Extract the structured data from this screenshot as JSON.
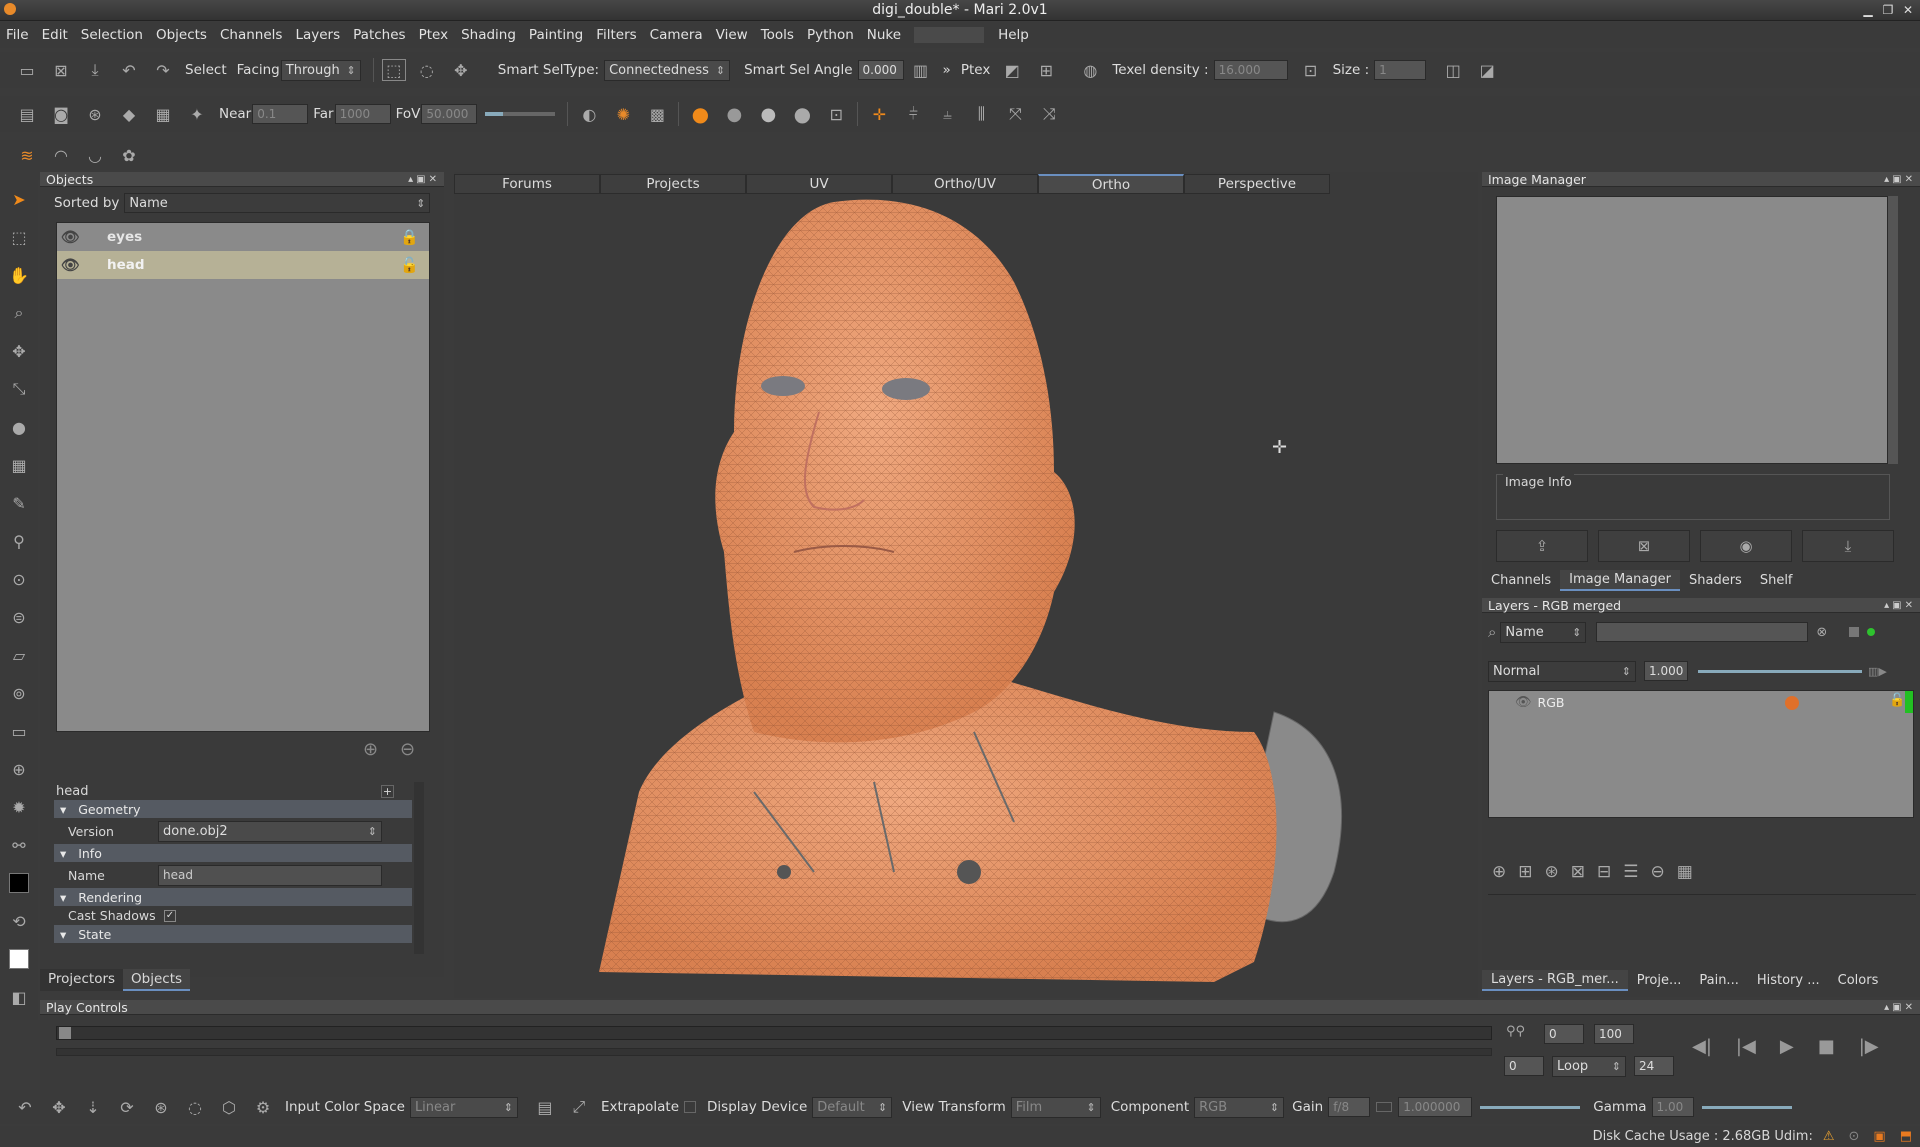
{
  "title": "digi_double* - Mari 2.0v1",
  "menu": [
    "File",
    "Edit",
    "Selection",
    "Objects",
    "Channels",
    "Layers",
    "Patches",
    "Ptex",
    "Shading",
    "Painting",
    "Filters",
    "Camera",
    "View",
    "Tools",
    "Python",
    "Nuke",
    "Help"
  ],
  "toolbar1": {
    "select": "Select",
    "facing": "Facing",
    "facing_value": "Through",
    "smart_seltype": "Smart SelType:",
    "smart_seltype_value": "Connectedness",
    "smart_sel_angle": "Smart Sel Angle",
    "smart_sel_angle_value": "0.000",
    "ptex": "Ptex",
    "texel_density": "Texel density :",
    "texel_density_value": "16.000",
    "size": "Size :",
    "size_value": "1"
  },
  "toolbar2": {
    "near": "Near",
    "near_value": "0.1",
    "far": "Far",
    "far_value": "1000",
    "fov": "FoV",
    "fov_value": "50.000"
  },
  "objects": {
    "header": "Objects",
    "sorted_by": "Sorted by",
    "sort_value": "Name",
    "items": [
      {
        "name": "eyes"
      },
      {
        "name": "head"
      }
    ]
  },
  "props": {
    "object": "head",
    "geometry": "Geometry",
    "version_label": "Version",
    "version_value": "done.obj2",
    "info": "Info",
    "name_label": "Name",
    "name_value": "head",
    "rendering": "Rendering",
    "cast_shadows": "Cast Shadows",
    "state": "State"
  },
  "left_tabs": [
    "Projectors",
    "Objects"
  ],
  "view_tabs": [
    "Forums",
    "Projects",
    "UV",
    "Ortho/UV",
    "Ortho",
    "Perspective"
  ],
  "image_manager": {
    "header": "Image Manager",
    "info": "Image Info"
  },
  "right_tabs": [
    "Channels",
    "Image Manager",
    "Shaders",
    "Shelf"
  ],
  "layers": {
    "header": "Layers - RGB merged",
    "filter": "Name",
    "blend": "Normal",
    "opacity": "1.000",
    "layer": "RGB"
  },
  "bottom_right_tabs": [
    "Layers - RGB_mer...",
    "Proje...",
    "Pain...",
    "History ...",
    "Colors"
  ],
  "play": {
    "header": "Play Controls",
    "start": "0",
    "end": "100",
    "frame": "0",
    "loop": "Loop",
    "fps": "24"
  },
  "bottombar": {
    "input_cs": "Input Color Space",
    "input_cs_value": "Linear",
    "extrapolate": "Extrapolate",
    "display_device": "Display Device",
    "display_device_value": "Default",
    "view_transform": "View Transform",
    "view_transform_value": "Film",
    "component": "Component",
    "component_value": "RGB",
    "gain": "Gain",
    "gain_value": "f/8",
    "gain_value2": "1.000000",
    "gamma": "Gamma",
    "gamma_value": "1.00"
  },
  "status": "Disk Cache Usage : 2.68GB Udim:"
}
